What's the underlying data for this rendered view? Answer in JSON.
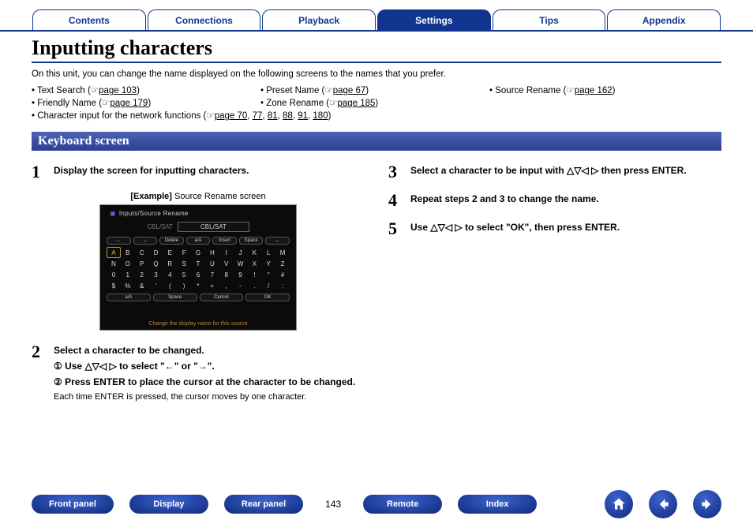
{
  "tabs": {
    "contents": "Contents",
    "connections": "Connections",
    "playback": "Playback",
    "settings": "Settings",
    "tips": "Tips",
    "appendix": "Appendix"
  },
  "title": "Inputting characters",
  "intro": "On this unit, you can change the name displayed on the following screens to the names that you prefer.",
  "bullets": {
    "text_search": "Text Search",
    "text_search_page": "page 103",
    "preset_name": "Preset Name",
    "preset_name_page": "page 67",
    "source_rename": "Source Rename",
    "source_rename_page": "page 162",
    "friendly_name": "Friendly Name",
    "friendly_name_page": "page 179",
    "zone_rename": "Zone Rename",
    "zone_rename_page": "page 185",
    "char_input": "Character input for the network functions",
    "char_input_pages": [
      "page 70",
      "77",
      "81",
      "88",
      "91",
      "180"
    ]
  },
  "section": "Keyboard screen",
  "steps": {
    "s1": {
      "num": "1",
      "lead": "Display the screen for inputting characters."
    },
    "example_label_bold": "[Example]",
    "example_label_text": " Source Rename screen",
    "s2": {
      "num": "2",
      "lead": "Select a character to be changed.",
      "sub1_pre": "① Use ",
      "sub1_arrows": "△▽◁ ▷",
      "sub1_mid": " to select \"",
      "sub1_left": "←",
      "sub1_or": "\" or \"",
      "sub1_right": "→",
      "sub1_end": "\".",
      "sub2": "② Press ENTER to place the cursor at the character to be changed.",
      "note": "Each time ENTER is pressed, the cursor moves by one character."
    },
    "s3": {
      "num": "3",
      "pre": "Select a character to be input with ",
      "arrows": "△▽◁ ▷",
      "post": " then press ENTER."
    },
    "s4": {
      "num": "4",
      "lead": "Repeat steps 2 and 3 to change the name."
    },
    "s5": {
      "num": "5",
      "pre": "Use ",
      "arrows": "△▽◁ ▷",
      "post": " to select \"OK\", then press ENTER."
    }
  },
  "keyboard": {
    "header": "Inputs/Source Rename",
    "cursor_label": "CBL/SAT",
    "cursor_value": "CBL/SAT",
    "pills": [
      "←",
      "→",
      "Delete",
      "a/A",
      "Insert",
      "Space",
      "←"
    ],
    "rows": [
      [
        "A",
        "B",
        "C",
        "D",
        "E",
        "F",
        "G",
        "H",
        "I",
        "J",
        "K",
        "L",
        "M"
      ],
      [
        "N",
        "O",
        "P",
        "Q",
        "R",
        "S",
        "T",
        "U",
        "V",
        "W",
        "X",
        "Y",
        "Z"
      ],
      [
        "0",
        "1",
        "2",
        "3",
        "4",
        "5",
        "6",
        "7",
        "8",
        "9",
        "!",
        "\"",
        "#"
      ],
      [
        "$",
        "%",
        "&",
        "'",
        "(",
        ")",
        "*",
        "+",
        ",",
        "-",
        ".",
        "/",
        ":"
      ]
    ],
    "bottom_pills": [
      "a/A",
      "Space",
      "Cancel",
      "OK"
    ],
    "footer": "Change the display name for this source"
  },
  "bottom": {
    "front_panel": "Front panel",
    "display": "Display",
    "rear_panel": "Rear panel",
    "page": "143",
    "remote": "Remote",
    "index": "Index"
  }
}
